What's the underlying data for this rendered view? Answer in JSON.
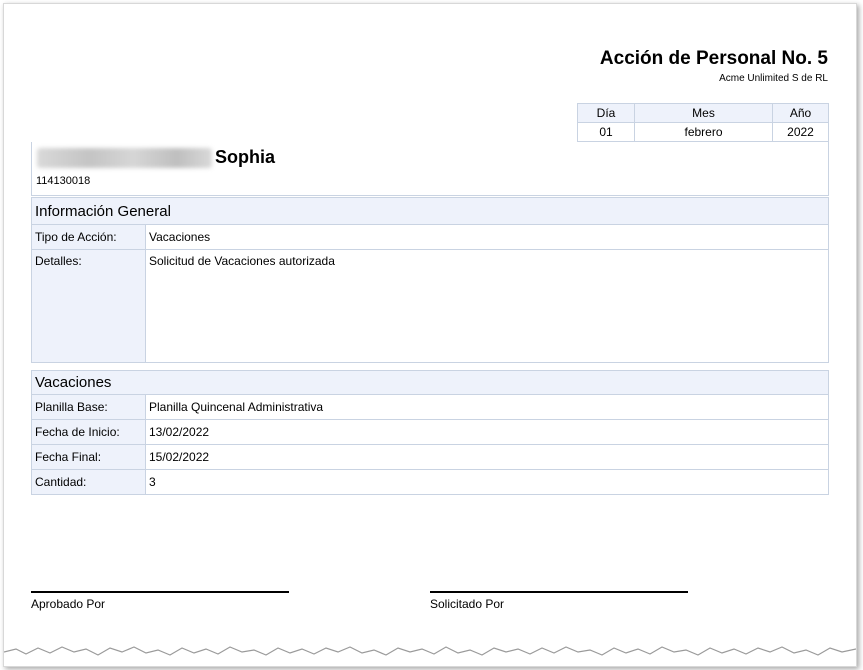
{
  "document": {
    "title": "Acción de Personal No. 5",
    "company": "Acme Unlimited S de RL"
  },
  "date_table": {
    "headers": [
      "Día",
      "Mes",
      "Año"
    ],
    "values": [
      "01",
      "febrero",
      "2022"
    ]
  },
  "employee": {
    "name": "Sophia",
    "id": "114130018"
  },
  "general": {
    "heading": "Información General",
    "rows": [
      {
        "label": "Tipo de Acción:",
        "value": "Vacaciones"
      },
      {
        "label": "Detalles:",
        "value": "Solicitud de Vacaciones autorizada"
      }
    ]
  },
  "vacaciones": {
    "heading": "Vacaciones",
    "rows": [
      {
        "label": "Planilla Base:",
        "value": "Planilla Quincenal Administrativa"
      },
      {
        "label": "Fecha de Inicio:",
        "value": "13/02/2022"
      },
      {
        "label": "Fecha Final:",
        "value": "15/02/2022"
      },
      {
        "label": "Cantidad:",
        "value": "3"
      }
    ]
  },
  "signatures": {
    "approved": "Aprobado Por",
    "requested": "Solicitado Por"
  }
}
